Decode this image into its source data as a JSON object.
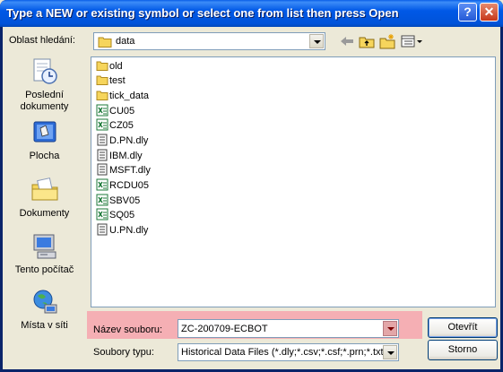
{
  "window": {
    "title": "Type a NEW or existing symbol or select one from list then press Open"
  },
  "look_in": {
    "label": "Oblast hledání:",
    "value": "data"
  },
  "toolbar": {
    "icons": [
      "back-arrow-icon",
      "up-folder-icon",
      "new-folder-icon",
      "view-menu-icon"
    ]
  },
  "places": [
    {
      "label": "Poslední dokumenty",
      "icon": "recent-documents-icon"
    },
    {
      "label": "Plocha",
      "icon": "desktop-icon"
    },
    {
      "label": "Dokumenty",
      "icon": "my-documents-icon"
    },
    {
      "label": "Tento počítač",
      "icon": "my-computer-icon"
    },
    {
      "label": "Místa v síti",
      "icon": "network-places-icon"
    }
  ],
  "files": [
    {
      "name": "old",
      "type": "folder"
    },
    {
      "name": "test",
      "type": "folder"
    },
    {
      "name": "tick_data",
      "type": "folder"
    },
    {
      "name": "CU05",
      "type": "excel"
    },
    {
      "name": "CZ05",
      "type": "excel"
    },
    {
      "name": "D.PN.dly",
      "type": "document"
    },
    {
      "name": "IBM.dly",
      "type": "document"
    },
    {
      "name": "MSFT.dly",
      "type": "document"
    },
    {
      "name": "RCDU05",
      "type": "excel"
    },
    {
      "name": "SBV05",
      "type": "excel"
    },
    {
      "name": "SQ05",
      "type": "excel"
    },
    {
      "name": "U.PN.dly",
      "type": "document"
    }
  ],
  "file_name": {
    "label": "Název souboru:",
    "value": "ZC-200709-ECBOT"
  },
  "file_type": {
    "label": "Soubory typu:",
    "value": "Historical Data Files (*.dly;*.csv;*.csf;*.prn;*.txt)"
  },
  "buttons": {
    "open": "Otevřít",
    "cancel": "Storno"
  }
}
